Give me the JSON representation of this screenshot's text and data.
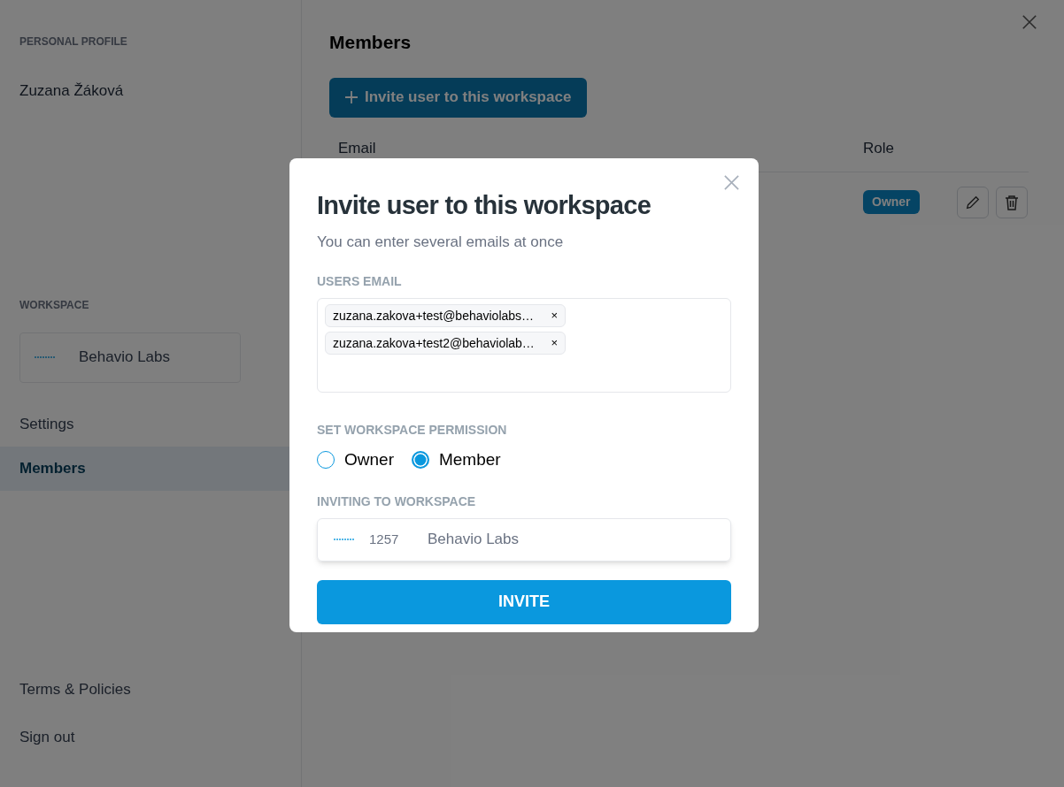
{
  "sidebar": {
    "profile_heading": "PERSONAL PROFILE",
    "user_name": "Zuzana Žáková",
    "workspace_heading": "WORKSPACE",
    "workspace_name": "Behavio Labs",
    "nav_items": [
      {
        "label": "Settings",
        "selected": false
      },
      {
        "label": "Members",
        "selected": true
      }
    ],
    "footer_links": [
      "Terms & Policies",
      "Sign out"
    ]
  },
  "main": {
    "title": "Members",
    "invite_button": "Invite user to this workspace",
    "table": {
      "columns": [
        "Email",
        "Role"
      ],
      "rows": [
        {
          "role": "Owner"
        }
      ]
    }
  },
  "modal": {
    "title": "Invite user to this workspace",
    "subtitle": "You can enter several emails at once",
    "email_label": "USERS EMAIL",
    "emails": [
      "zuzana.zakova+test@behaviolabs…",
      "zuzana.zakova+test2@behaviolab…"
    ],
    "chip_remove": "×",
    "permission_label": "SET WORKSPACE PERMISSION",
    "permissions": [
      {
        "label": "Owner",
        "selected": false
      },
      {
        "label": "Member",
        "selected": true
      }
    ],
    "workspace_label": "INVITING TO WORKSPACE",
    "workspace_id": "1257",
    "workspace_name": "Behavio Labs",
    "submit": "INVITE"
  }
}
